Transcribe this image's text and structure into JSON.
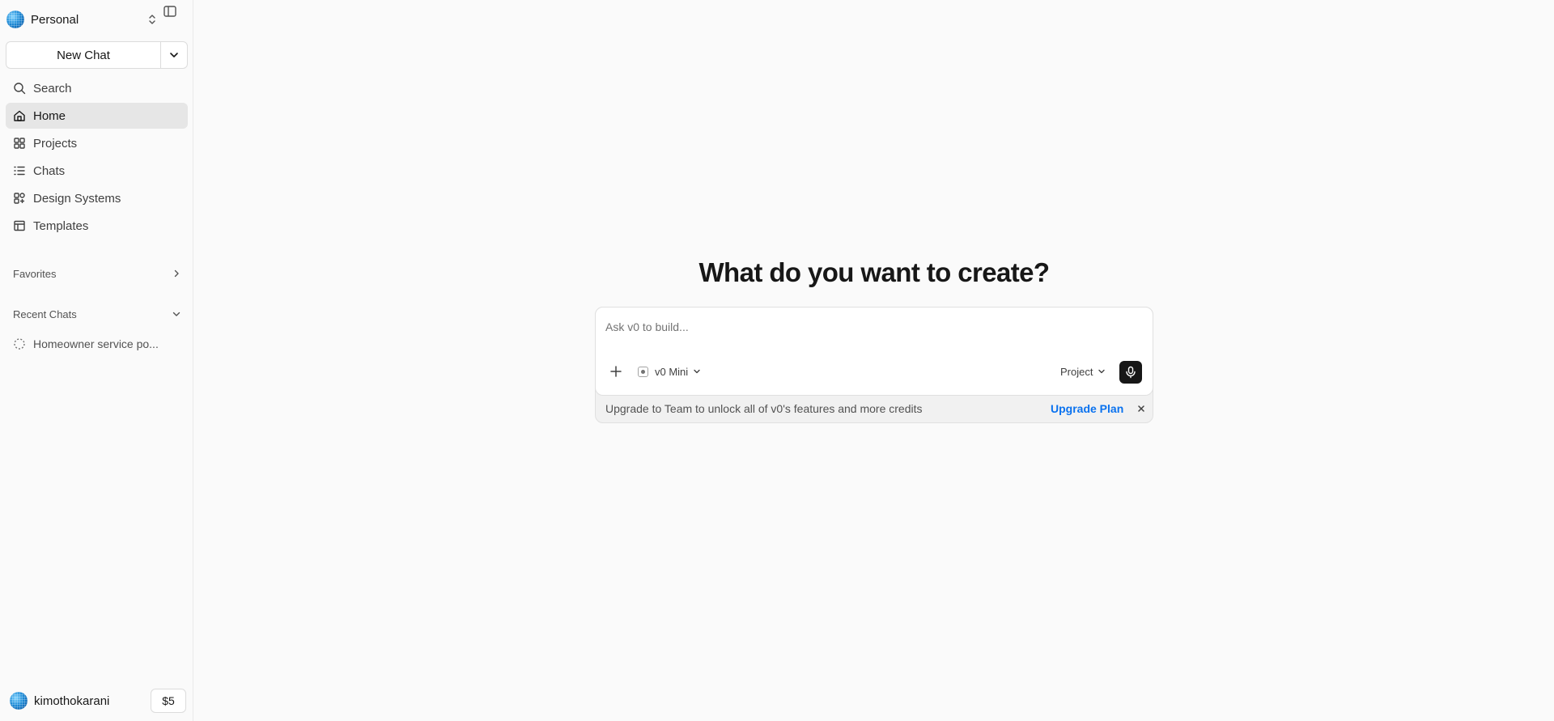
{
  "sidebar": {
    "team_name": "Personal",
    "new_chat_label": "New Chat",
    "nav": [
      {
        "label": "Search",
        "icon": "search-icon"
      },
      {
        "label": "Home",
        "icon": "home-icon",
        "active": true
      },
      {
        "label": "Projects",
        "icon": "grid-icon"
      },
      {
        "label": "Chats",
        "icon": "list-icon"
      },
      {
        "label": "Design Systems",
        "icon": "shapes-icon"
      },
      {
        "label": "Templates",
        "icon": "table-icon"
      }
    ],
    "favorites_label": "Favorites",
    "recent_chats_label": "Recent Chats",
    "recent_chats": [
      {
        "label": "Homeowner service po..."
      }
    ],
    "user": {
      "username": "kimothokarani",
      "credits": "$5"
    }
  },
  "main": {
    "heading": "What do you want to create?",
    "composer": {
      "placeholder": "Ask v0 to build...",
      "model_label": "v0 Mini",
      "project_label": "Project"
    },
    "upgrade_banner": {
      "text": "Upgrade to Team to unlock all of v0's features and more credits",
      "link": "Upgrade Plan"
    }
  },
  "colors": {
    "background": "#fafafa",
    "accent_link": "#0a72ef",
    "active_nav": "#e6e6e6",
    "mic_button": "#171717"
  }
}
